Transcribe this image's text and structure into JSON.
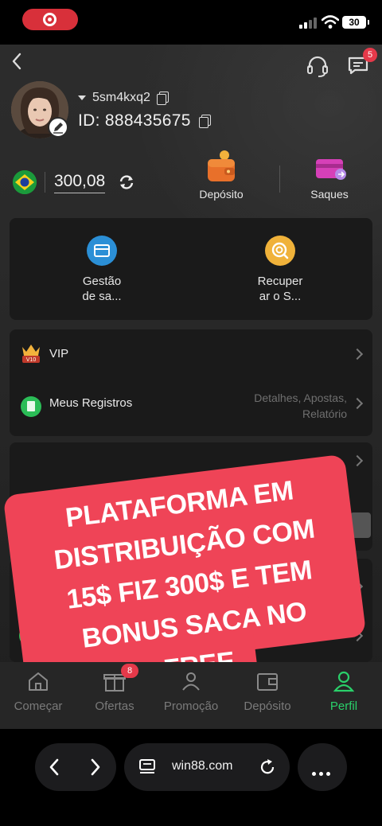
{
  "status_bar": {
    "battery": "30",
    "icons": [
      "screen-record-icon",
      "signal-icon",
      "wifi-icon",
      "battery-icon"
    ]
  },
  "header": {
    "message_badge": "5",
    "icons": [
      "back-arrow-icon",
      "headset-icon",
      "message-icon"
    ]
  },
  "profile": {
    "username": "5sm4kxq2",
    "id_label": "ID: 888435675"
  },
  "wallet": {
    "balance": "300,08",
    "deposit_label": "Depósito",
    "withdraw_label": "Saques"
  },
  "tools": [
    {
      "label": "Gestão\nde sa...",
      "icon": "wallet-card-icon",
      "color": "#2b8fd6"
    },
    {
      "label": "Recuper\nar o S...",
      "icon": "search-coin-icon",
      "color": "#f0b23a"
    }
  ],
  "menu": {
    "vip_label": "VIP",
    "vip_level": "V10",
    "records_label": "Meus Registros",
    "records_sub": "Detalhes, Apostas, Relatório"
  },
  "promo": {
    "text": "PLATAFORMA EM\nDISTRIBUIÇÃO COM\n15$ FIZ 300$ E TEM\nBONUS SACA NO\nFREE",
    "color": "#ef4457"
  },
  "tabbar": {
    "tabs": [
      {
        "label": "Começar",
        "icon": "home-icon"
      },
      {
        "label": "Ofertas",
        "icon": "gift-icon"
      },
      {
        "label": "Promoção",
        "icon": "people-icon"
      },
      {
        "label": "Depósito",
        "icon": "wallet-icon"
      },
      {
        "label": "Perfil",
        "icon": "user-icon"
      }
    ],
    "offers_badge": "8",
    "active_color": "#2ad06a"
  },
  "browser": {
    "url": "win88.com"
  }
}
